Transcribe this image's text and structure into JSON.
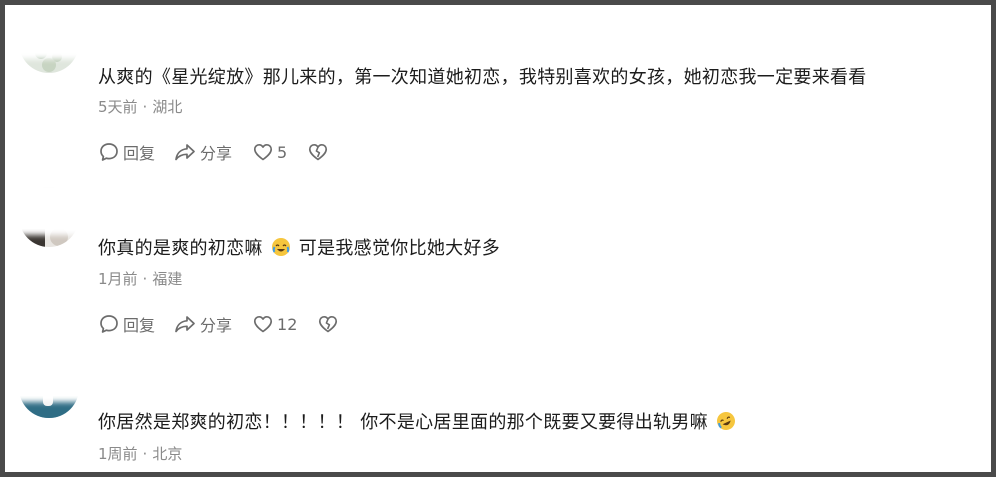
{
  "comments": [
    {
      "text": "从爽的《星光绽放》那儿来的，第一次知道她初恋，我特别喜欢的女孩，她初恋我一定要来看看",
      "time": "5天前",
      "location": "湖北",
      "reply_label": "回复",
      "share_label": "分享",
      "likes": "5"
    },
    {
      "text": "你真的是爽的初恋嘛",
      "text_after_emoji": "可是我感觉你比她大好多",
      "time": "1月前",
      "location": "福建",
      "reply_label": "回复",
      "share_label": "分享",
      "likes": "12"
    },
    {
      "text": "你居然是郑爽的初恋！！！！！ 你不是心居里面的那个既要又要得出轨男嘛",
      "time": "1周前",
      "location": "北京"
    }
  ],
  "separator": "·",
  "icons": [
    "comment-bubble-icon",
    "share-arrow-icon",
    "heart-icon",
    "broken-heart-icon",
    "crying-laughing-emoji",
    "rofl-emoji"
  ],
  "colors": {
    "text": "#1c1c1c",
    "meta": "#8a8a8a",
    "action": "#6c6c6c"
  }
}
